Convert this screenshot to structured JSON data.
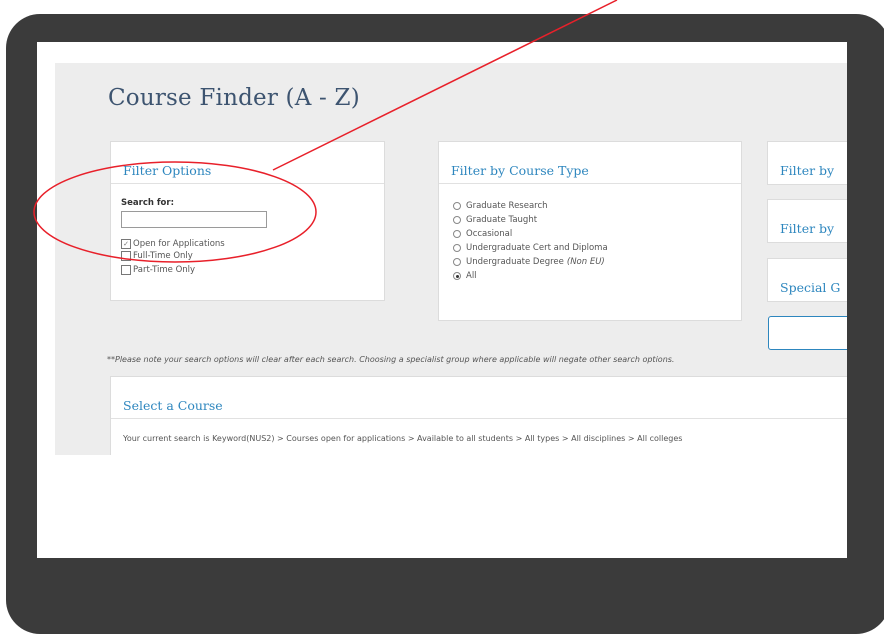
{
  "page_title": "Course Finder (A - Z)",
  "filter_options": {
    "heading": "Filter Options",
    "search_label": "Search for:",
    "search_value": "",
    "checkboxes": [
      {
        "label": "Open for Applications",
        "checked": true
      },
      {
        "label": "Full-Time Only",
        "checked": false
      },
      {
        "label": "Part-Time Only",
        "checked": false
      }
    ]
  },
  "course_type": {
    "heading": "Filter by Course Type",
    "options": [
      {
        "label": "Graduate Research",
        "note": "",
        "selected": false
      },
      {
        "label": "Graduate Taught",
        "note": "",
        "selected": false
      },
      {
        "label": "Occasional",
        "note": "",
        "selected": false
      },
      {
        "label": "Undergraduate Cert and Diploma",
        "note": "",
        "selected": false
      },
      {
        "label": "Undergraduate Degree",
        "note": "(Non EU)",
        "selected": false
      },
      {
        "label": "All",
        "note": "",
        "selected": true
      }
    ]
  },
  "right_cards": [
    "Filter by",
    "Filter by",
    "Special G"
  ],
  "search_note": "**Please note your search options will clear after each search. Choosing a specialist group where applicable will negate other search options.",
  "select_course": {
    "heading": "Select a Course",
    "current_search": "Your current search is Keyword(NUS2) > Courses open for applications > Available to all students > All types > All disciplines > All colleges"
  },
  "colors": {
    "heading_blue": "#2d86be",
    "title_navy": "#3d5470",
    "device_frame": "#3b3b3b",
    "annotation_red": "#e8202a",
    "content_bg": "#ededed"
  }
}
